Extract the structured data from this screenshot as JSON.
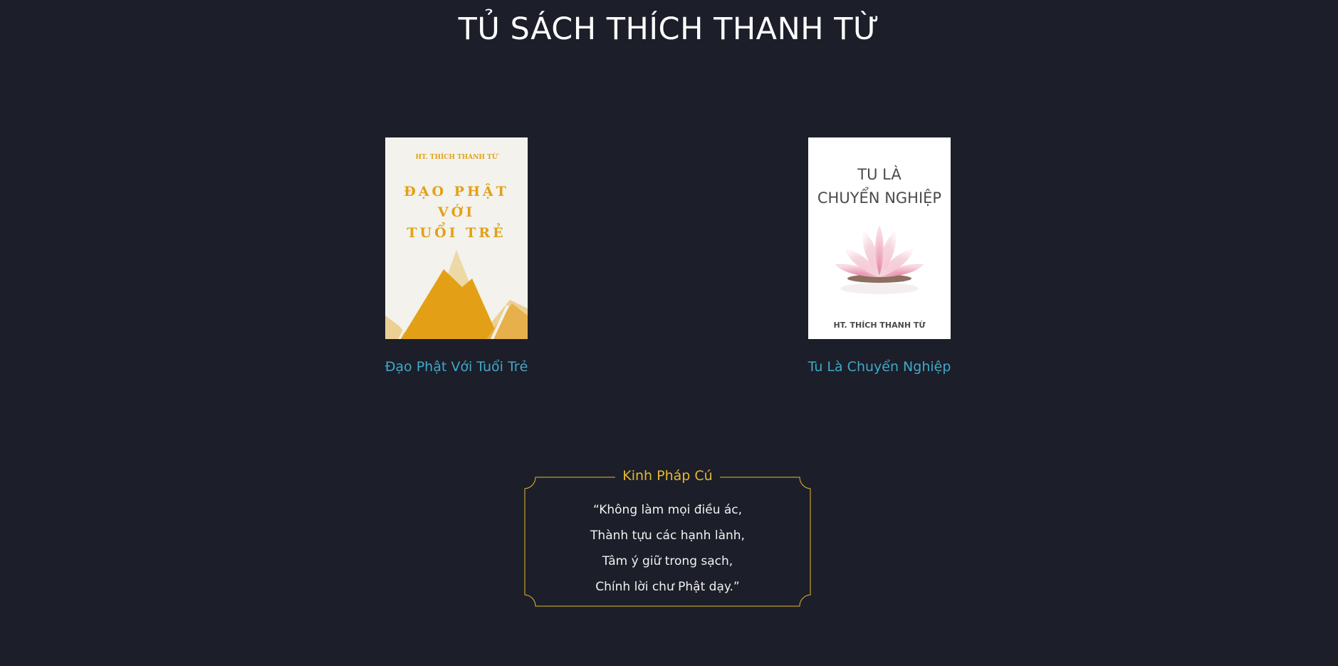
{
  "page": {
    "title": "TỦ SÁCH THÍCH THANH TỪ"
  },
  "books": [
    {
      "title": "Đạo Phật Với Tuổi Trẻ",
      "cover_author": "HT. THÍCH THANH TỪ",
      "cover_title_lines": [
        "ĐẠO PHẬT",
        "VỚI",
        "TUỔI TRẺ"
      ]
    },
    {
      "title": "Tu Là Chuyển Nghiệp",
      "cover_author": "HT. THÍCH THANH TỪ",
      "cover_title_lines": [
        "TU LÀ",
        "CHUYỂN NGHIỆP"
      ]
    }
  ],
  "quote": {
    "heading": "Kinh Pháp Cú",
    "lines": [
      "“Không làm mọi điều ác,",
      "Thành tựu các hạnh lành,",
      "Tâm ý giữ trong sạch,",
      "Chính lời chư Phật dạy.”"
    ]
  },
  "colors": {
    "background": "#1c1e29",
    "link": "#41a8c8",
    "accent_gold": "#e6b830"
  }
}
